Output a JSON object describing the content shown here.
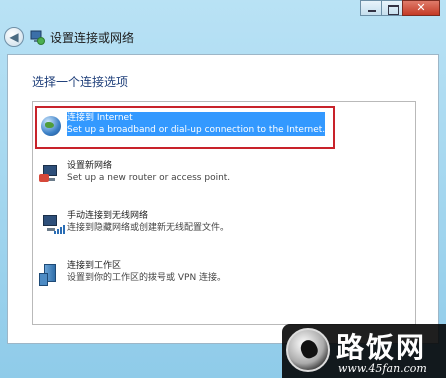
{
  "window": {
    "controls": [
      "minimize",
      "maximize",
      "close"
    ]
  },
  "nav": {
    "back_icon": "back-arrow-icon",
    "title": "设置连接或网络"
  },
  "content": {
    "heading": "选择一个连接选项",
    "options": [
      {
        "title": "连接到 Internet",
        "subtitle": "Set up a broadband or dial-up connection to the Internet.",
        "icon": "globe-icon",
        "selected": true
      },
      {
        "title": "设置新网络",
        "subtitle": "Set up a new router or access point.",
        "icon": "router-icon",
        "selected": false
      },
      {
        "title": "手动连接到无线网络",
        "subtitle": "连接到隐藏网络或创建新无线配置文件。",
        "icon": "wireless-icon",
        "selected": false
      },
      {
        "title": "连接到工作区",
        "subtitle": "设置到你的工作区的拨号或 VPN 连接。",
        "icon": "workplace-icon",
        "selected": false
      }
    ]
  },
  "watermark": {
    "brand": "路饭网",
    "url": "www.45fan.com"
  },
  "colors": {
    "selection": "#3399ff",
    "highlight_border": "#c8222a",
    "heading": "#1f3f7a"
  }
}
